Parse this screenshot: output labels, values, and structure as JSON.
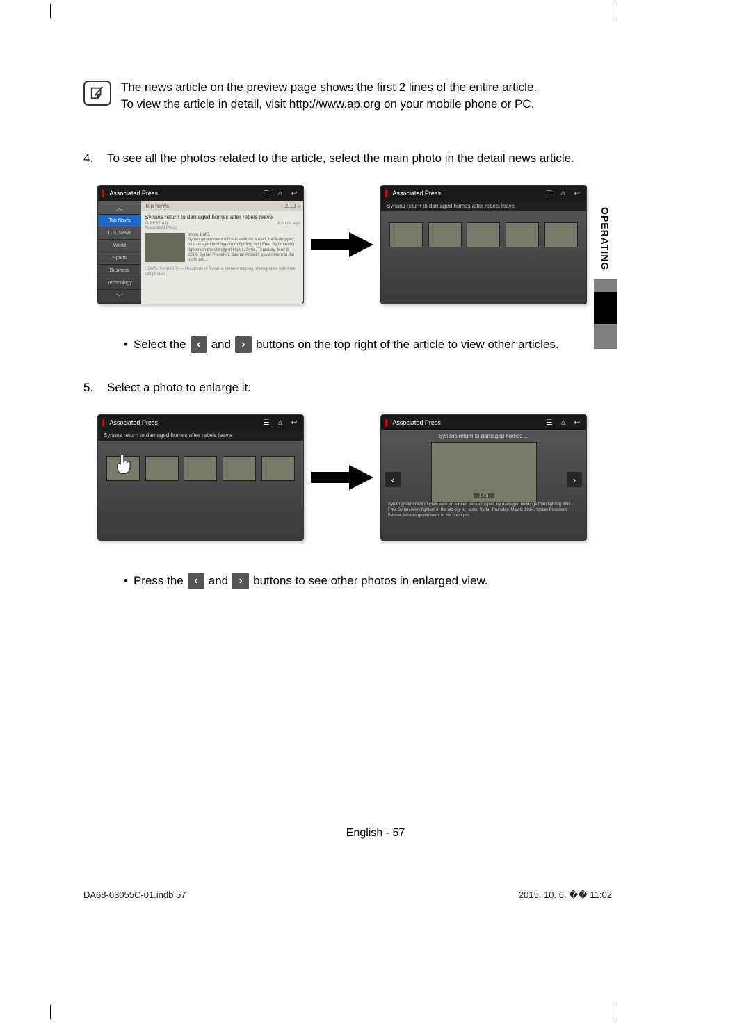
{
  "note": {
    "line1": "The news article on the preview page shows the first 2 lines of the entire article.",
    "line2": "To view the article in detail, visit http://www.ap.org on your mobile phone or PC."
  },
  "step4": {
    "num": "4.",
    "text": "To see all the photos related to the article, select the main photo in the detail news article."
  },
  "bullet1": {
    "pre": "Select the",
    "mid": "and",
    "post": "buttons on the top right of the article to view other articles."
  },
  "step5": {
    "num": "5.",
    "text": "Select a photo to enlarge it."
  },
  "bullet2": {
    "pre": "Press the",
    "mid": "and",
    "post": "buttons to see other photos in enlarged view."
  },
  "pane": {
    "brand": "Associated Press",
    "topnews": "Top News",
    "pager_detail": "2/10",
    "headline": "Syrians return to damaged homes after rebels leave",
    "subheadline": "Syrians return to damaged homes after rebels leave",
    "source": "ALBERT AJI",
    "agency": "Associated Press",
    "timeago": "8 hours ago",
    "photo_count": "photo 1 of 5",
    "caption": "Syrian government officials walk on a road, back-dropped, by damaged buildings from fighting with Free Syrian Army fighters in the old city of Homs, Syria, Thursday, May 8, 2014. Syrian President Bashar Assad's government in the north pro...",
    "footer": "HOMS, Syria (AP) — Hundreds of Syrians, some snapping photographs with their cell phones,",
    "enlarge_sub": "Syrians return to damaged homes ...",
    "enlarge_pager": "1 / 5",
    "enlarge_caption": "Syrian government officials walk on a road, back-dropped, by damaged buildings from fighting with Free Syrian Army fighters in the old city of Homs, Syria, Thursday, May 8, 2014. Syrian President Bashar Assad's government in the north pro..."
  },
  "nav": {
    "items": [
      "Top News",
      "U.S. News",
      "World",
      "Sports",
      "Business",
      "Technology"
    ],
    "active_index": 0
  },
  "sidetab": "OPERATING",
  "page_footer": "English - 57",
  "print": {
    "file": "DA68-03055C-01.indb   57",
    "stamp": "2015. 10. 6.   �� 11:02"
  }
}
